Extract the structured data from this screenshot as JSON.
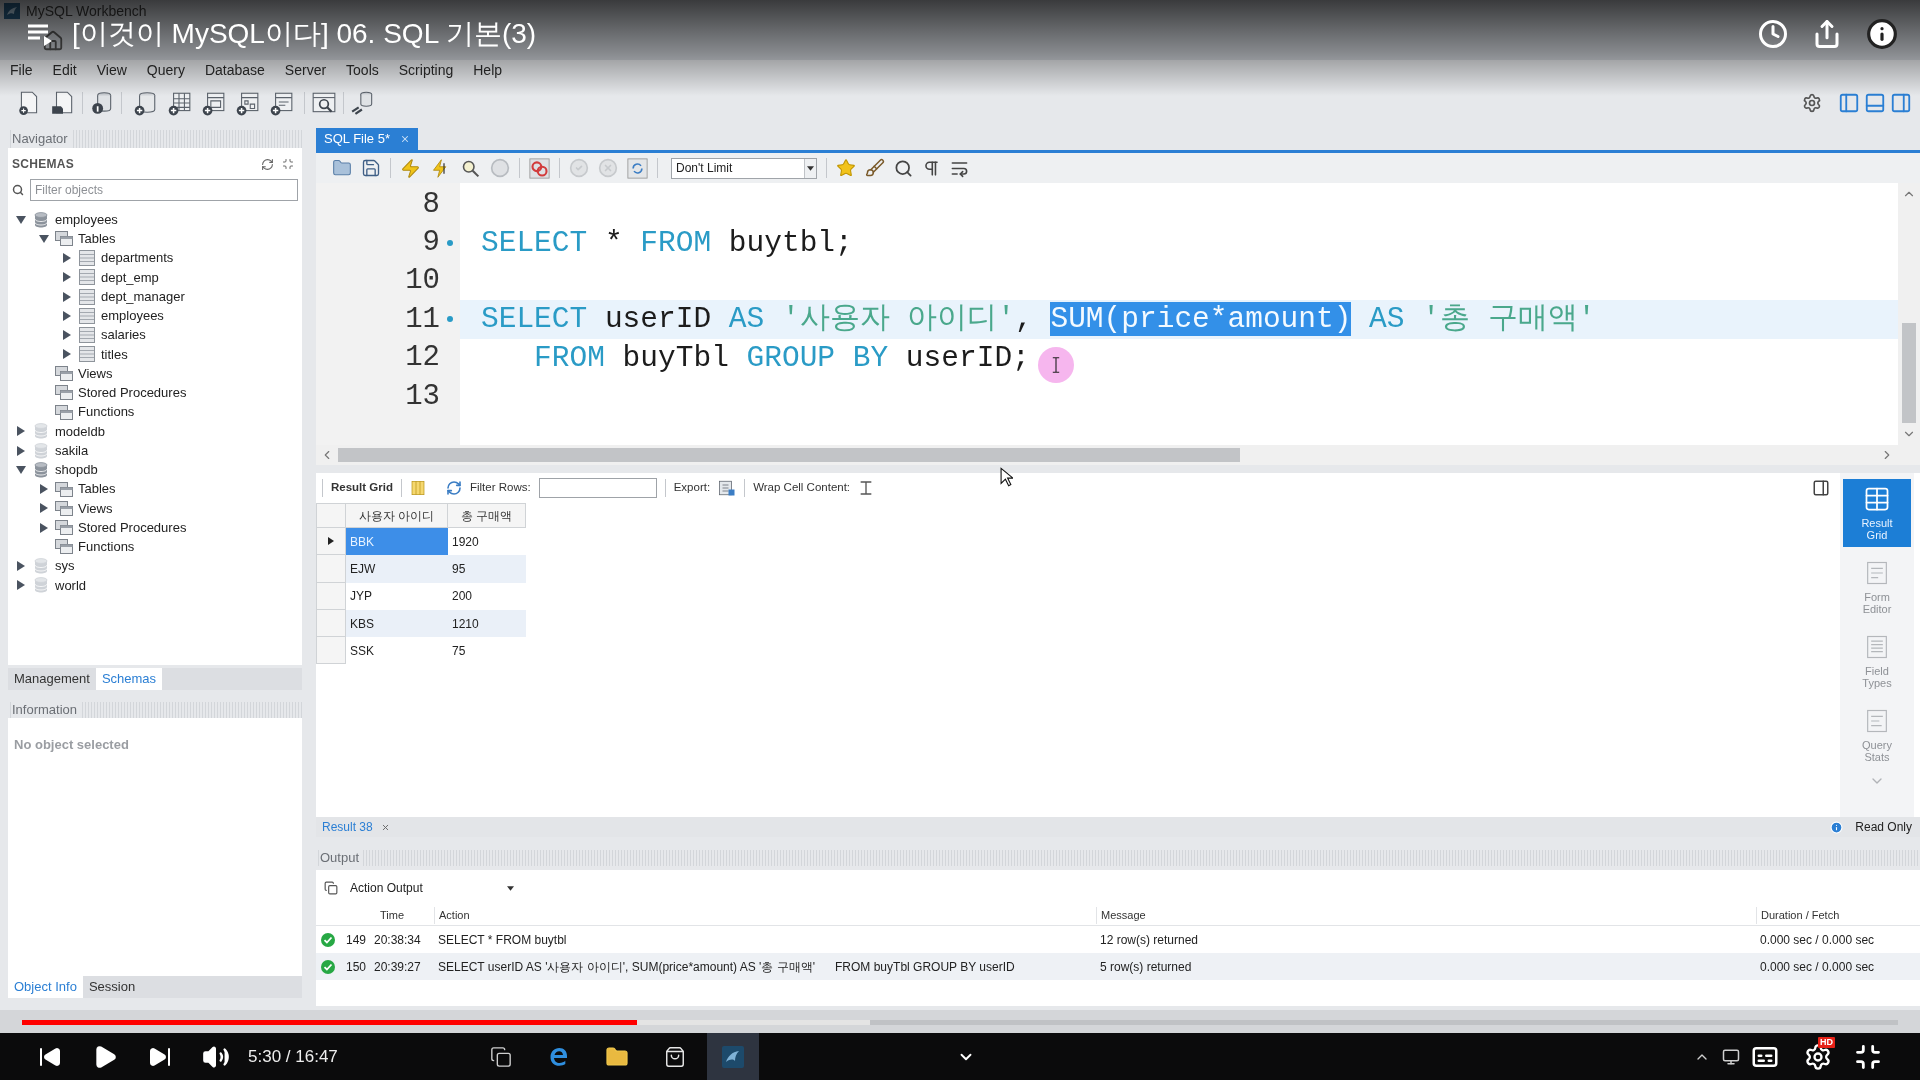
{
  "video": {
    "title": "[이것이 MySQL이다] 06. SQL 기본(3)",
    "time": "5:30 / 16:47",
    "quality_badge": "HD",
    "played": {
      "level": 0.328
    },
    "buffered": {
      "level": 0.452
    }
  },
  "taskbar": [
    {
      "kind": "task_view",
      "selected": false
    },
    {
      "kind": "browser",
      "selected": false
    },
    {
      "kind": "files",
      "selected": false
    },
    {
      "kind": "store",
      "selected": false
    },
    {
      "kind": "database_app",
      "selected": true
    }
  ],
  "app": {
    "title": "MySQL Workbench",
    "menu": [
      "File",
      "Edit",
      "View",
      "Query",
      "Database",
      "Server",
      "Tools",
      "Scripting",
      "Help"
    ]
  },
  "navigator": {
    "title": "Navigator",
    "section": "SCHEMAS",
    "filter": {
      "placeholder": "Filter objects"
    },
    "tree": [
      {
        "label": "employees",
        "kind": "schema",
        "expanded": true,
        "children": [
          {
            "label": "Tables",
            "kind": "folder",
            "expanded": true,
            "children": [
              {
                "label": "departments",
                "kind": "table",
                "expanded": false
              },
              {
                "label": "dept_emp",
                "kind": "table",
                "expanded": false
              },
              {
                "label": "dept_manager",
                "kind": "table",
                "expanded": false
              },
              {
                "label": "employees",
                "kind": "table",
                "expanded": false
              },
              {
                "label": "salaries",
                "kind": "table",
                "expanded": false
              },
              {
                "label": "titles",
                "kind": "table",
                "expanded": false
              }
            ]
          },
          {
            "label": "Views",
            "kind": "folder"
          },
          {
            "label": "Stored Procedures",
            "kind": "folder"
          },
          {
            "label": "Functions",
            "kind": "folder"
          }
        ]
      },
      {
        "label": "modeldb",
        "kind": "schema",
        "expanded": false
      },
      {
        "label": "sakila",
        "kind": "schema",
        "expanded": false
      },
      {
        "label": "shopdb",
        "kind": "schema",
        "expanded": true,
        "children": [
          {
            "label": "Tables",
            "kind": "folder",
            "expanded": false
          },
          {
            "label": "Views",
            "kind": "folder",
            "expanded": false
          },
          {
            "label": "Stored Procedures",
            "kind": "folder",
            "expanded": false
          },
          {
            "label": "Functions",
            "kind": "folder"
          }
        ]
      },
      {
        "label": "sys",
        "kind": "schema",
        "expanded": false
      },
      {
        "label": "world",
        "kind": "schema",
        "expanded": false
      }
    ],
    "tabs": [
      {
        "label": "Management",
        "selected": false
      },
      {
        "label": "Schemas",
        "selected": true
      }
    ],
    "information": {
      "title": "Information",
      "message": "No object selected"
    },
    "bottom_tabs": [
      {
        "label": "Object Info",
        "selected": true
      },
      {
        "label": "Session",
        "selected": false
      }
    ]
  },
  "editor": {
    "tabs": [
      {
        "label": "SQL File 5*",
        "selected": true
      }
    ],
    "limit": "Don't Limit",
    "lines": [
      {
        "number": "8",
        "marker": false,
        "current": false
      },
      {
        "number": "9",
        "marker": true,
        "current": false,
        "tokens": [
          {
            "text": "SELECT",
            "kind": "keyword",
            "selected": false
          },
          {
            "text": " * ",
            "kind": "plain",
            "selected": false
          },
          {
            "text": "FROM",
            "kind": "keyword",
            "selected": false
          },
          {
            "text": " buytbl;",
            "kind": "plain",
            "selected": false
          }
        ]
      },
      {
        "number": "10",
        "marker": false,
        "current": false
      },
      {
        "number": "11",
        "marker": true,
        "current": true,
        "tokens": [
          {
            "text": "SELECT",
            "kind": "keyword",
            "selected": false
          },
          {
            "text": " userID ",
            "kind": "plain",
            "selected": false
          },
          {
            "text": "AS",
            "kind": "keyword",
            "selected": false
          },
          {
            "text": " '사용자 아이디'",
            "kind": "string",
            "selected": false
          },
          {
            "text": ", ",
            "kind": "plain",
            "selected": false
          },
          {
            "text": "SUM(price*amount)",
            "kind": "plain",
            "selected": true
          },
          {
            "text": " AS",
            "kind": "keyword",
            "selected": false
          },
          {
            "text": " '총 구매액'",
            "kind": "string",
            "selected": false
          }
        ]
      },
      {
        "number": "12",
        "marker": false,
        "current": false,
        "tokens": [
          {
            "text": "   FROM",
            "kind": "keyword",
            "selected": false
          },
          {
            "text": " buyTbl ",
            "kind": "plain",
            "selected": false
          },
          {
            "text": "GROUP BY",
            "kind": "keyword",
            "selected": false
          },
          {
            "text": " userID;",
            "kind": "plain",
            "selected": false
          }
        ]
      },
      {
        "number": "13",
        "marker": false,
        "current": false
      }
    ]
  },
  "results": {
    "title": "Result Grid",
    "filter_label": "Filter Rows:",
    "export_label": "Export:",
    "wrap_label": "Wrap Cell Content:",
    "columns": [
      "사용자 아이디",
      "총 구매액"
    ],
    "rows": [
      {
        "cells": [
          "BBK",
          "1920"
        ],
        "selected": true
      },
      {
        "cells": [
          "EJW",
          "95"
        ],
        "selected": false
      },
      {
        "cells": [
          "JYP",
          "200"
        ],
        "selected": false
      },
      {
        "cells": [
          "KBS",
          "1210"
        ],
        "selected": false
      },
      {
        "cells": [
          "SSK",
          "75"
        ],
        "selected": false
      }
    ],
    "side_tabs": [
      {
        "label": "Result Grid",
        "selected": true
      },
      {
        "label": "Form Editor",
        "selected": false
      },
      {
        "label": "Field Types",
        "selected": false
      },
      {
        "label": "Query Stats",
        "selected": false
      }
    ],
    "result_tabs": [
      {
        "label": "Result 38",
        "selected": true
      }
    ],
    "read_only": "Read Only"
  },
  "output": {
    "title": "Output",
    "mode": "Action Output",
    "columns": [
      "Time",
      "Action",
      "Message",
      "Duration / Fetch"
    ],
    "rows": [
      {
        "kind": "success",
        "number": "149",
        "time": "20:38:34",
        "action": "SELECT * FROM buytbl",
        "message": "12 row(s) returned",
        "duration": "0.000 sec / 0.000 sec",
        "selected": false
      },
      {
        "kind": "success",
        "number": "150",
        "time": "20:39:27",
        "action": "SELECT userID AS '사용자 아이디', SUM(price*amount) AS '총 구매액'      FROM buyTbl GROUP BY userID",
        "message": "5 row(s) returned",
        "duration": "0.000 sec / 0.000 sec",
        "selected": true
      }
    ]
  }
}
